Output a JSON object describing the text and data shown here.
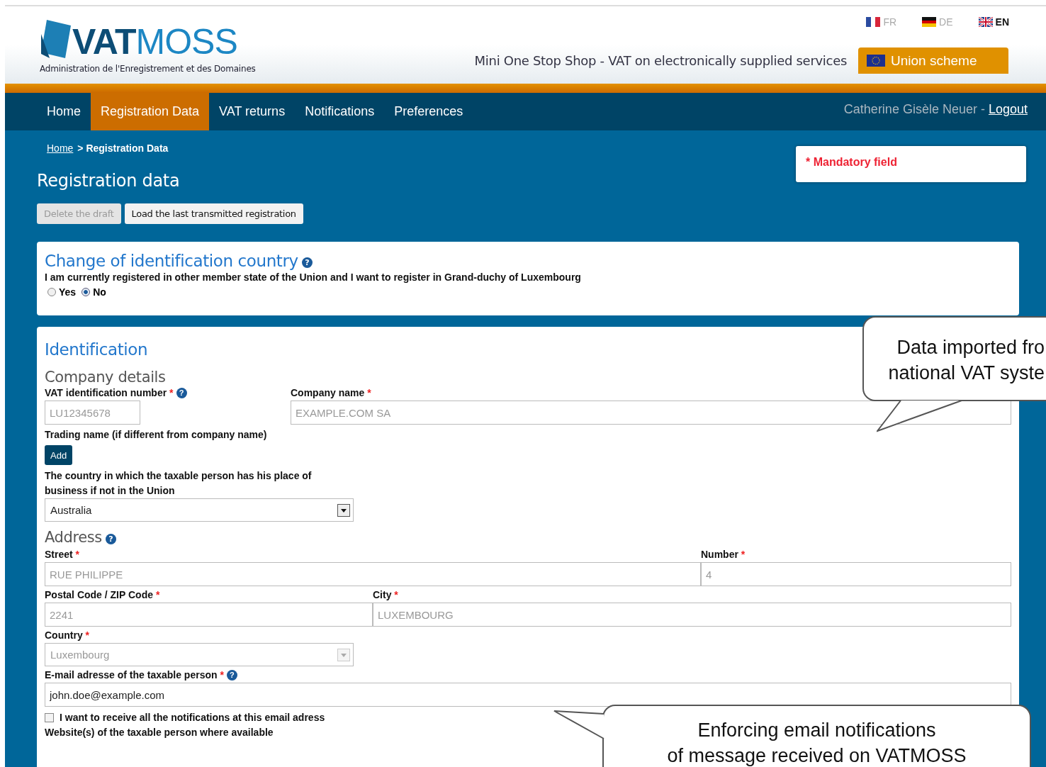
{
  "header": {
    "logo_bold": "VAT",
    "logo_light": "MOSS",
    "organization": "Administration de l'Enregistrement et des Domaines",
    "tagline": "Mini One Stop Shop - VAT on electronically supplied services",
    "languages": [
      {
        "code": "FR",
        "selected": false
      },
      {
        "code": "DE",
        "selected": false
      },
      {
        "code": "EN",
        "selected": true
      }
    ],
    "scheme_tab": "Union scheme"
  },
  "nav": {
    "items": [
      {
        "label": "Home",
        "selected": false
      },
      {
        "label": "Registration Data",
        "selected": true
      },
      {
        "label": "VAT returns",
        "selected": false
      },
      {
        "label": "Notifications",
        "selected": false
      },
      {
        "label": "Preferences",
        "selected": false
      }
    ],
    "user": "Catherine Gisèle Neuer -",
    "logout": "Logout"
  },
  "breadcrumb": {
    "link": "Home",
    "current": "> Registration Data"
  },
  "legend": {
    "mark": "*",
    "text": "Mandatory field"
  },
  "page_title": "Registration data",
  "actions": [
    {
      "label": "Delete the draft",
      "disabled": true
    },
    {
      "label": "Load the last transmitted registration",
      "disabled": false
    }
  ],
  "change_country": {
    "title": "Change of identification country",
    "help": "?",
    "question": "I am currently registered in other member state of the Union and I want to register in Grand-duchy of Luxembourg",
    "options": [
      {
        "label": "Yes",
        "selected": false
      },
      {
        "label": "No",
        "selected": true
      }
    ]
  },
  "identification": {
    "title": "Identification",
    "company_title": "Company details",
    "vat_number": {
      "label": "VAT identification number",
      "required_mark": "*",
      "help": "?",
      "value": "LU12345678",
      "disabled": true
    },
    "company_name": {
      "label": "Company name",
      "required_mark": "*",
      "value": "EXAMPLE.COM SA",
      "disabled": true
    },
    "trading_name": {
      "label": "Trading name (if different from company name)",
      "button": "Add"
    },
    "outside_country": {
      "label": "The country in which the taxable person has his place of business if not in the Union",
      "value": "Australia",
      "disabled": false
    },
    "address_title": "Address",
    "address_help": "?",
    "street": {
      "label": "Street",
      "required_mark": "*",
      "value": "RUE PHILIPPE",
      "disabled": true
    },
    "number": {
      "label": "Number",
      "required_mark": "*",
      "value": "4",
      "disabled": true
    },
    "postal_code": {
      "label": "Postal Code / ZIP Code",
      "required_mark": "*",
      "value": "2241",
      "disabled": true
    },
    "city": {
      "label": "City",
      "required_mark": "*",
      "value": "LUXEMBOURG",
      "disabled": true
    },
    "country": {
      "label": "Country",
      "required_mark": "*",
      "value": "Luxembourg",
      "disabled": true
    },
    "email": {
      "label": "E-mail adresse of the taxable person",
      "required_mark": "*",
      "help": "?",
      "value": "john.doe@example.com",
      "disabled": false
    },
    "notify": {
      "label": "I want to receive all the notifications at this email adress",
      "checked": false
    },
    "website": {
      "label": "Website(s) of the taxable person where available"
    }
  },
  "callouts": [
    {
      "lines": [
        "Data imported fro",
        "national VAT syste"
      ]
    },
    {
      "lines": [
        "Enforcing email notifications",
        "of message received on VATMOSS"
      ]
    }
  ]
}
